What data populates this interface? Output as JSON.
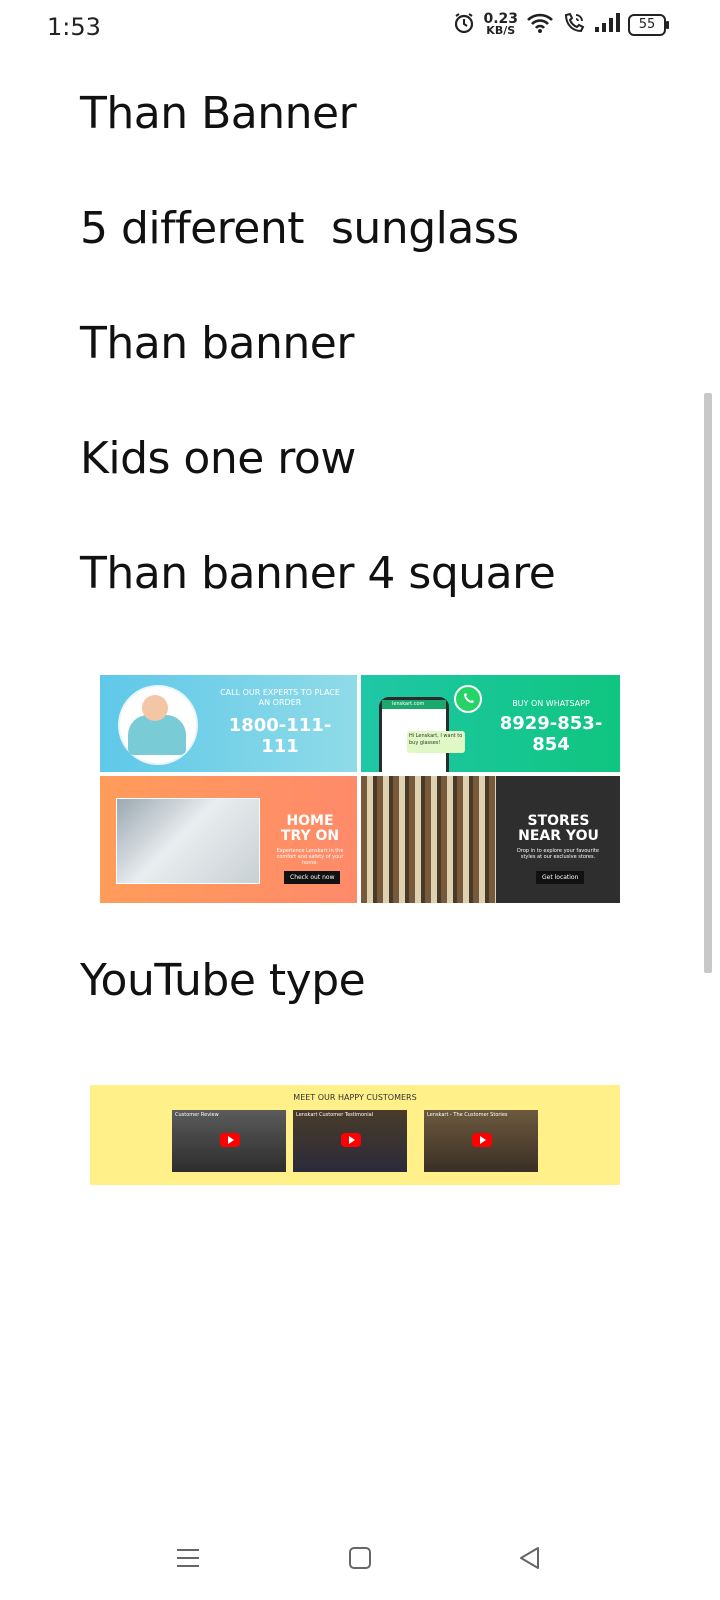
{
  "status_bar": {
    "time": "1:53",
    "net_speed_value": "0.23",
    "net_speed_unit": "KB/S",
    "battery": "55"
  },
  "doc": {
    "lines": [
      "Than Banner",
      "5 different  sunglass",
      "Than banner",
      "Kids one row",
      "Than banner 4 square",
      "YouTube type"
    ]
  },
  "banner_grid": {
    "call": {
      "text": "CALL OUR EXPERTS TO PLACE AN ORDER",
      "number": "1800-111-111"
    },
    "whatsapp": {
      "text": "BUY ON WHATSAPP",
      "number": "8929-853-854",
      "bubble": "Hi Lenskart, I want to buy glasses!",
      "phone_header": "lenskart.com"
    },
    "home": {
      "title_line1": "HOME",
      "title_line2": "TRY ON",
      "sub": "Experience Lenskart in the comfort and safety of your home.",
      "button": "Check out now"
    },
    "stores": {
      "title_line1": "STORES",
      "title_line2": "NEAR YOU",
      "sub": "Drop in to explore your favourite styles at our exclusive stores.",
      "button": "Get location"
    }
  },
  "youtube_banner": {
    "title": "MEET OUR HAPPY CUSTOMERS",
    "videos": [
      {
        "caption": "Customer Review"
      },
      {
        "caption": "Lenskart Customer Testimonial"
      },
      {
        "caption": "Lenskart - The Customer Stories"
      }
    ]
  }
}
